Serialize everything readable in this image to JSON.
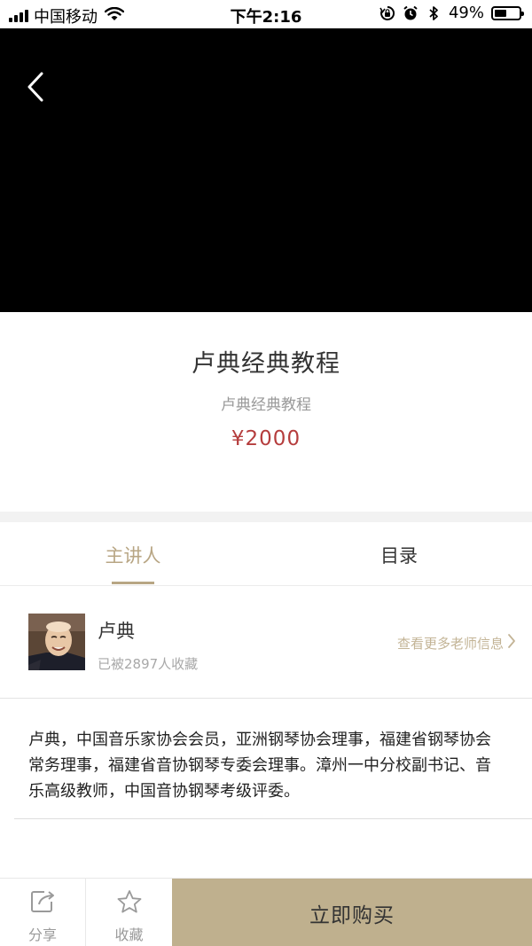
{
  "status_bar": {
    "carrier": "中国移动",
    "time": "下午2:16",
    "battery_percent_label": "49%",
    "battery_level": 0.49,
    "icons": [
      "signal-icon",
      "wifi-icon",
      "orientation-lock-icon",
      "alarm-icon",
      "bluetooth-icon",
      "battery-icon"
    ]
  },
  "video": {
    "back_icon": "chevron-left-icon"
  },
  "course": {
    "title": "卢典经典教程",
    "subtitle": "卢典经典教程",
    "price": "¥2000",
    "price_color": "#b53d3d"
  },
  "tabs": [
    {
      "label": "主讲人",
      "active": true
    },
    {
      "label": "目录",
      "active": false
    }
  ],
  "teacher": {
    "name": "卢典",
    "collected": "已被2897人收藏",
    "more_info": "查看更多老师信息"
  },
  "description": "卢典，中国音乐家协会会员，亚洲钢琴协会理事，福建省钢琴协会常务理事，福建省音协钢琴专委会理事。漳州一中分校副书记、音乐高级教师，中国音协钢琴考级评委。",
  "bottom_bar": {
    "share_label": "分享",
    "favorite_label": "收藏",
    "buy_label": "立即购买",
    "buy_color": "#bfb08e"
  },
  "colors": {
    "accent": "#b8a684",
    "price": "#b53d3d"
  }
}
